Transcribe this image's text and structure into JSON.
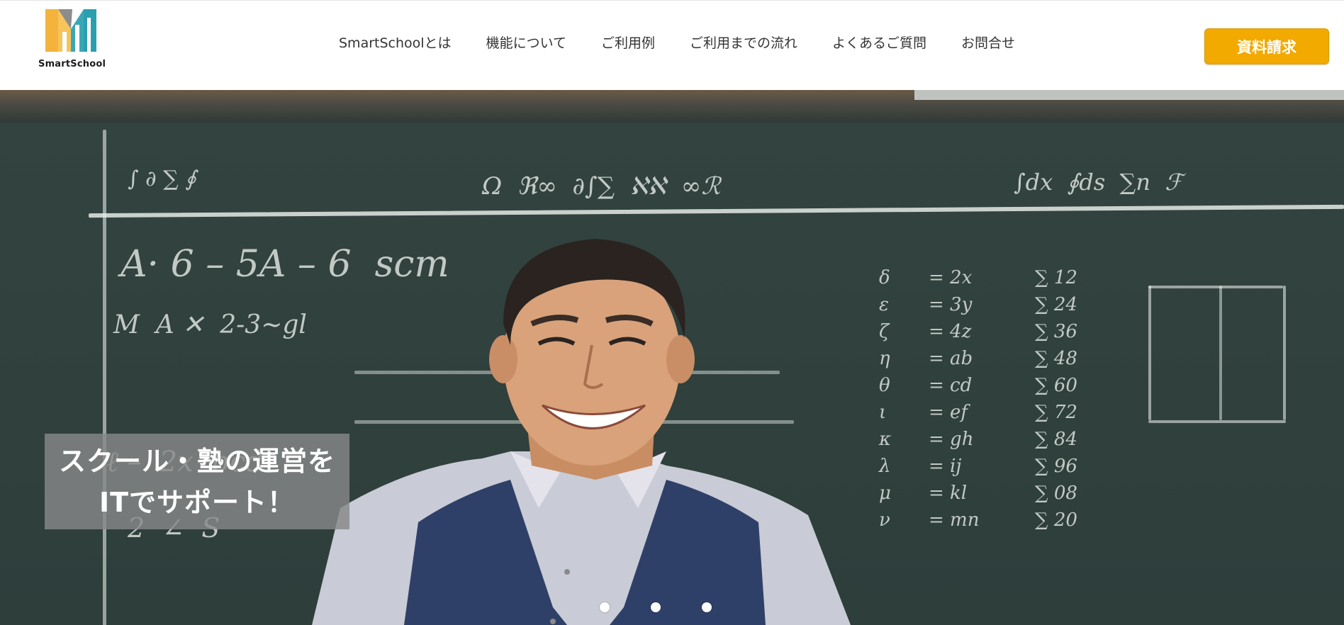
{
  "brand": {
    "name": "SmartSchool",
    "logo_icon": "smartschool-logo-icon",
    "colors": {
      "orange": "#f0a935",
      "teal": "#2a9fb0",
      "dark": "#1c1c1c"
    }
  },
  "nav": {
    "items": [
      {
        "label": "SmartSchoolとは"
      },
      {
        "label": "機能について"
      },
      {
        "label": "ご利用例"
      },
      {
        "label": "ご利用までの流れ"
      },
      {
        "label": "よくあるご質問"
      },
      {
        "label": "お問合せ"
      }
    ]
  },
  "cta": {
    "label": "資料請求",
    "color": "#f2a900"
  },
  "hero": {
    "caption_lines": [
      "スクール・塾の運営を",
      "ITでサポート！"
    ],
    "slides": {
      "count": 3,
      "active": 1
    },
    "image": "teacher-smiling-in-front-of-chalkboard"
  }
}
